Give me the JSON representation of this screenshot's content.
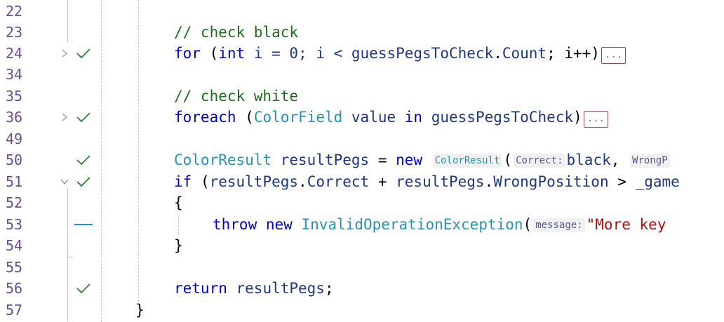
{
  "editor": {
    "lines": [
      {
        "num": "22"
      },
      {
        "num": "23",
        "comment": "// check black"
      },
      {
        "num": "24",
        "kw_for": "for",
        "p1": " (",
        "kw_int": "int",
        "p2": " i = 0; i < ",
        "id1": "guessPegsToCheck",
        "p3": ".",
        "id2": "Count",
        "p4": "; i++)",
        "collapsed": "..."
      },
      {
        "num": "34"
      },
      {
        "num": "35",
        "comment": "// check white"
      },
      {
        "num": "36",
        "kw_foreach": "foreach",
        "p1": " (",
        "tp1": "ColorField",
        "p2": " ",
        "id1": "value",
        "p3": " ",
        "kw_in": "in",
        "p4": " ",
        "id2": "guessPegsToCheck",
        "p5": ")",
        "collapsed": "..."
      },
      {
        "num": "49"
      },
      {
        "num": "50",
        "tp1": "ColorResult",
        "p1": " ",
        "id1": "resultPegs",
        "p2": " = ",
        "kw_new": "new",
        "hint_type": "ColorResult",
        "p3": "(",
        "hint1": "Correct:",
        "id2": "black",
        "p4": ",",
        "hint2": "WrongP"
      },
      {
        "num": "51",
        "kw_if": "if",
        "p1": " (",
        "id1": "resultPegs",
        "p2": ".",
        "id2": "Correct",
        "p3": " + ",
        "id3": "resultPegs",
        "p4": ".",
        "id4": "WrongPosition",
        "p5": " > ",
        "id5": "_game"
      },
      {
        "num": "52",
        "brace": "{"
      },
      {
        "num": "53",
        "kw_throw": "throw",
        "p1": " ",
        "kw_new": "new",
        "p2": " ",
        "tp1": "InvalidOperationException",
        "p3": "(",
        "hint1": "message:",
        "str1": "\"More key"
      },
      {
        "num": "54",
        "brace": "}"
      },
      {
        "num": "55"
      },
      {
        "num": "56",
        "kw_return": "return",
        "p1": " ",
        "id1": "resultPegs",
        "p2": ";"
      },
      {
        "num": "57",
        "brace": "}"
      }
    ]
  },
  "colors": {
    "keyword": "#0000c8",
    "comment": "#1f6b1f",
    "type": "#2b91af",
    "identifier": "#1f377f",
    "line_number": "#6a4c93",
    "check": "#2e7d32",
    "change_marker": "#1e90d6"
  }
}
